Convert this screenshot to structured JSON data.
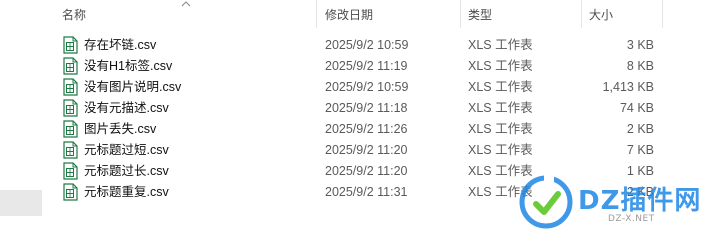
{
  "header": {
    "name": "名称",
    "date": "修改日期",
    "type": "类型",
    "size": "大小"
  },
  "files": [
    {
      "name": "存在坏链.csv",
      "date": "2025/9/2 10:59",
      "type": "XLS 工作表",
      "size": "3 KB"
    },
    {
      "name": "没有H1标签.csv",
      "date": "2025/9/2 11:19",
      "type": "XLS 工作表",
      "size": "8 KB"
    },
    {
      "name": "没有图片说明.csv",
      "date": "2025/9/2 10:59",
      "type": "XLS 工作表",
      "size": "1,413 KB"
    },
    {
      "name": "没有元描述.csv",
      "date": "2025/9/2 11:18",
      "type": "XLS 工作表",
      "size": "74 KB"
    },
    {
      "name": "图片丢失.csv",
      "date": "2025/9/2 11:26",
      "type": "XLS 工作表",
      "size": "2 KB"
    },
    {
      "name": "元标题过短.csv",
      "date": "2025/9/2 11:20",
      "type": "XLS 工作表",
      "size": "7 KB"
    },
    {
      "name": "元标题过长.csv",
      "date": "2025/9/2 11:20",
      "type": "XLS 工作表",
      "size": "1 KB"
    },
    {
      "name": "元标题重复.csv",
      "date": "2025/9/2 11:31",
      "type": "XLS 工作表",
      "size": "2 KB"
    }
  ],
  "watermark": {
    "logo_text": "DZ插件网",
    "url_text": "DZ-X.NET"
  },
  "icons": {
    "file": "excel-csv-file-icon",
    "sort": "sort-up-chevron-icon"
  },
  "colors": {
    "file_icon": "#1f7a45",
    "watermark_blue": "#1e88e5",
    "watermark_green": "#52c41a"
  }
}
